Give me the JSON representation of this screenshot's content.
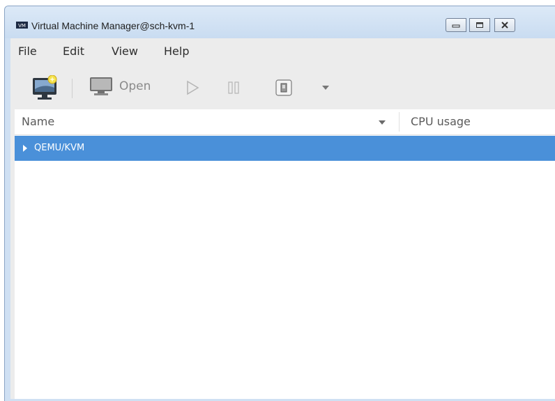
{
  "window": {
    "title": "Virtual Machine Manager@sch-kvm-1",
    "app_icon": "vmm-app-icon",
    "controls": [
      "minimize-icon",
      "maximize-icon",
      "close-icon"
    ]
  },
  "menubar": {
    "items": [
      {
        "label": "File"
      },
      {
        "label": "Edit"
      },
      {
        "label": "View"
      },
      {
        "label": "Help"
      }
    ]
  },
  "toolbar": {
    "new_vm_icon": "new-vm-icon",
    "open_label": "Open",
    "run_icon": "play-icon",
    "pause_icon": "pause-icon",
    "shutdown_icon": "shutdown-icon",
    "shutdown_menu_icon": "chevron-down-icon"
  },
  "list": {
    "columns": [
      "Name",
      "CPU usage"
    ],
    "rows": [
      {
        "label": "QEMU/KVM",
        "selected": true,
        "expanded": false
      }
    ]
  },
  "colors": {
    "selection": "#4a90d9",
    "window_frame": "#cfe0f3",
    "toolbar_bg": "#ececec"
  }
}
